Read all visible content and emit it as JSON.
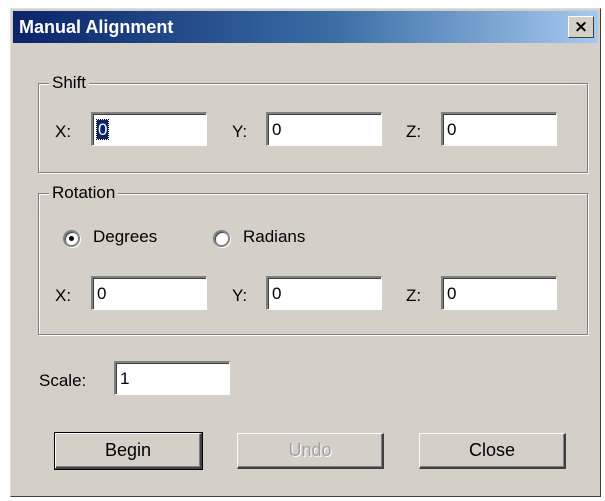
{
  "window": {
    "title": "Manual Alignment",
    "close_glyph": "×"
  },
  "shift": {
    "legend": "Shift",
    "x_label": "X:",
    "x_value": "0",
    "y_label": "Y:",
    "y_value": "0",
    "z_label": "Z:",
    "z_value": "0"
  },
  "rotation": {
    "legend": "Rotation",
    "degrees_label": "Degrees",
    "degrees_selected": true,
    "radians_label": "Radians",
    "radians_selected": false,
    "x_label": "X:",
    "x_value": "0",
    "y_label": "Y:",
    "y_value": "0",
    "z_label": "Z:",
    "z_value": "0"
  },
  "scale": {
    "label": "Scale:",
    "value": "1"
  },
  "buttons": {
    "begin": "Begin",
    "undo": "Undo",
    "close": "Close"
  },
  "colors": {
    "title_bar_start": "#0a246a",
    "title_bar_end": "#a6caf0",
    "face": "#d4d0c8",
    "selection": "#0a246a"
  }
}
